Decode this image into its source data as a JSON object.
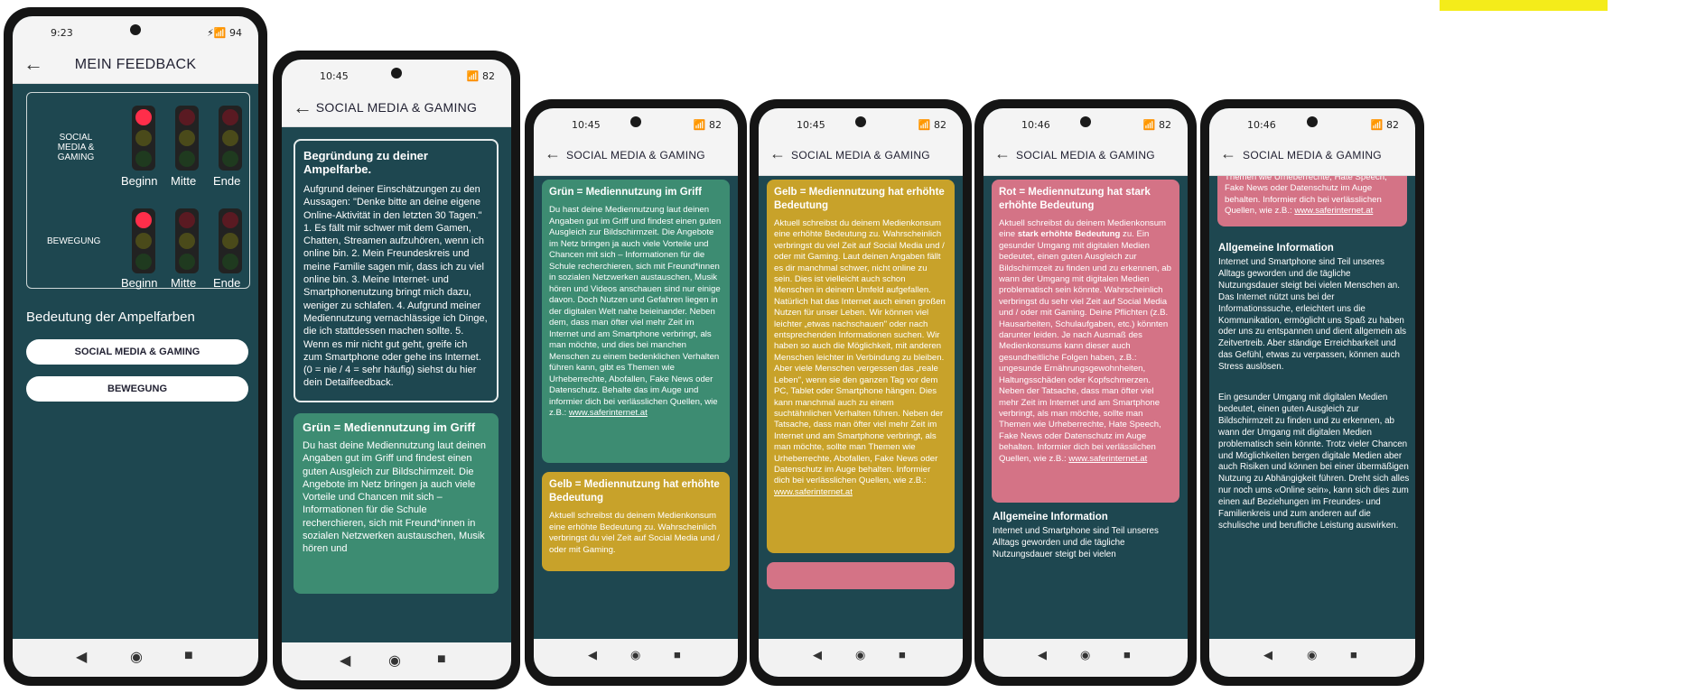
{
  "colors": {
    "teal": "#1e4750",
    "green": "#3d8c72",
    "yellow": "#c8a22a",
    "pink": "#d47386"
  },
  "phone1": {
    "status_time": "9:23",
    "status_icons": "94",
    "title": "MEIN FEEDBACK",
    "row1_label": [
      "SOCIAL",
      "MEDIA &",
      "GAMING"
    ],
    "row2_label": "BEWEGUNG",
    "cols": [
      "Beginn",
      "Mitte",
      "Ende"
    ],
    "lights_social": [
      "red",
      "off",
      "off"
    ],
    "lights_bewegung": [
      "red",
      "off",
      "off"
    ],
    "section": "Bedeutung der Ampelfarben",
    "btn1": "SOCIAL MEDIA & GAMING",
    "btn2": "BEWEGUNG"
  },
  "phone2": {
    "status_time": "10:45",
    "status_icons": "82",
    "title": "SOCIAL MEDIA & GAMING",
    "box_title": "Begründung zu deiner Ampelfarbe.",
    "box_text": "Aufgrund deiner Einschätzungen zu den Aussagen: \"Denke bitte an deine eigene Online-Aktivität in den letzten 30 Tagen.\" 1. Es fällt mir schwer mit dem Gamen, Chatten, Streamen aufzuhören, wenn ich online bin. 2. Mein Freundeskreis und meine Familie sagen mir, dass ich zu viel online bin. 3. Meine Internet- und Smartphonenutzung bringt mich dazu, weniger zu schlafen. 4. Aufgrund meiner Mediennutzung vernachlässige ich Dinge, die ich stattdessen machen sollte. 5. Wenn es mir nicht gut geht, greife ich zum Smartphone oder gehe ins Internet. (0 = nie / 4 = sehr häufig) siehst du hier dein Detailfeedback.",
    "green_title": "Grün = Mediennutzung im Griff",
    "green_text": "Du hast deine Mediennutzung laut deinen Angaben gut im Griff und findest einen guten Ausgleich zur Bildschirmzeit. Die Angebote im Netz bringen ja auch viele Vorteile und Chancen mit sich – Informationen für die Schule recherchieren, sich mit Freund*innen in sozialen Netzwerken austauschen, Musik hören und"
  },
  "phone3": {
    "status_time": "10:45",
    "status_icons": "82",
    "title": "SOCIAL MEDIA & GAMING",
    "green_title": "Grün = Mediennutzung im Griff",
    "green_text": "Du hast deine Mediennutzung laut deinen Angaben gut im Griff und findest einen guten Ausgleich zur Bildschirmzeit. Die Angebote im Netz bringen ja auch viele Vorteile und Chancen mit sich – Informationen für die Schule recherchieren, sich mit Freund*innen in sozialen Netzwerken austauschen, Musik hören und Videos anschauen sind nur einige davon. Doch Nutzen und Gefahren liegen in der digitalen Welt nahe beieinander. Neben dem, dass man öfter viel mehr Zeit im Internet und am Smartphone verbringt, als man möchte, und dies bei manchen Menschen zu einem bedenklichen Verhalten führen kann, gibt es Themen wie Urheberrechte, Abofallen, Fake News oder Datenschutz. Behalte das im Auge und informier dich bei verlässlichen Quellen, wie z.B.:",
    "link": "www.saferinternet.at",
    "yellow_title": "Gelb = Mediennutzung hat erhöhte Bedeutung",
    "yellow_text": "Aktuell schreibst du deinem Medienkonsum eine erhöhte Bedeutung zu. Wahrscheinlich verbringst du viel Zeit auf Social Media und / oder mit Gaming."
  },
  "phone4": {
    "status_time": "10:45",
    "status_icons": "82",
    "title": "SOCIAL MEDIA & GAMING",
    "yellow_title": "Gelb = Mediennutzung hat erhöhte Bedeutung",
    "yellow_text": "Aktuell schreibst du deinem Medienkonsum eine erhöhte Bedeutung zu. Wahrscheinlich verbringst du viel Zeit auf Social Media und / oder mit Gaming. Laut deinen Angaben fällt es dir manchmal schwer, nicht online zu sein. Dies ist vielleicht auch schon Menschen in deinem Umfeld aufgefallen. Natürlich hat das Internet auch einen großen Nutzen für unser Leben. Wir können viel leichter „etwas nachschauen\" oder nach entsprechenden Informationen suchen. Wir haben so auch die Möglichkeit, mit anderen Menschen leichter in Verbindung zu bleiben. Aber viele Menschen vergessen das „reale Leben\", wenn sie den ganzen Tag vor dem PC, Tablet oder Smartphone hängen. Dies kann manchmal auch zu einem suchtähnlichen Verhalten führen. Neben der Tatsache, dass man öfter viel mehr Zeit im Internet und am Smartphone verbringt, als man möchte, sollte man Themen wie Urheberrechte, Abofallen, Fake News oder Datenschutz im Auge behalten. Informier dich bei verlässlichen Quellen, wie z.B.:",
    "link": "www.saferinternet.at"
  },
  "phone5": {
    "status_time": "10:46",
    "status_icons": "82",
    "title": "SOCIAL MEDIA & GAMING",
    "pink_title": "Rot = Mediennutzung hat stark erhöhte Bedeutung",
    "pink_text_a": "Aktuell schreibst du deinem Medienkonsum eine",
    "pink_bold": "stark erhöhte Bedeutung",
    "pink_text_b": "zu. Ein gesunder Umgang mit digitalen Medien bedeutet, einen guten Ausgleich zur Bildschirmzeit zu finden und zu erkennen, ab wann der Umgang mit digitalen Medien problematisch sein könnte. Wahrscheinlich verbringst du sehr viel Zeit auf Social Media und / oder mit Gaming. Deine Pflichten (z.B. Hausarbeiten, Schulaufgaben, etc.) könnten darunter leiden. Je nach Ausmaß des Medienkonsums kann dieser auch gesundheitliche Folgen haben, z.B.: ungesunde Ernährungsgewohnheiten, Haltungsschäden oder Kopfschmerzen. Neben der Tatsache, dass man öfter viel mehr Zeit im Internet und am Smartphone verbringt, als man möchte, sollte man Themen wie Urheberrechte, Hate Speech, Fake News oder Datenschutz im Auge behalten. Informier dich bei verlässlichen Quellen, wie z.B.:",
    "link": "www.saferinternet.at",
    "info_title": "Allgemeine Information",
    "info_text": "Internet und Smartphone sind Teil unseres Alltags geworden und die tägliche Nutzungsdauer steigt bei vielen"
  },
  "phone6": {
    "status_time": "10:46",
    "status_icons": "82",
    "title": "SOCIAL MEDIA & GAMING",
    "pink_text": "Themen wie Urheberrechte, Hate Speech, Fake News oder Datenschutz im Auge behalten. Informier dich bei verlässlichen Quellen, wie z.B.:",
    "link": "www.saferinternet.at",
    "info_title": "Allgemeine Information",
    "info_text1": "Internet und Smartphone sind Teil unseres Alltags geworden und die tägliche Nutzungsdauer steigt bei vielen Menschen an. Das Internet nützt uns bei der Informationssuche, erleichtert uns die Kommunikation, ermöglicht uns Spaß zu haben oder uns zu entspannen und dient allgemein als Zeitvertreib. Aber ständige Erreichbarkeit und das Gefühl, etwas zu verpassen, können auch Stress auslösen.",
    "info_text2": "Ein gesunder Umgang mit digitalen Medien bedeutet, einen guten Ausgleich zur Bildschirmzeit zu finden und zu erkennen, ab wann der Umgang mit digitalen Medien problematisch sein könnte. Trotz vieler Chancen und Möglichkeiten bergen digitale Medien aber auch Risiken und können bei einer übermäßigen Nutzung zu Abhängigkeit führen. Dreht sich alles nur noch ums «Online sein», kann sich dies zum einen auf Beziehungen im Freundes- und Familienkreis und zum anderen auf die schulische und berufliche Leistung auswirken."
  }
}
